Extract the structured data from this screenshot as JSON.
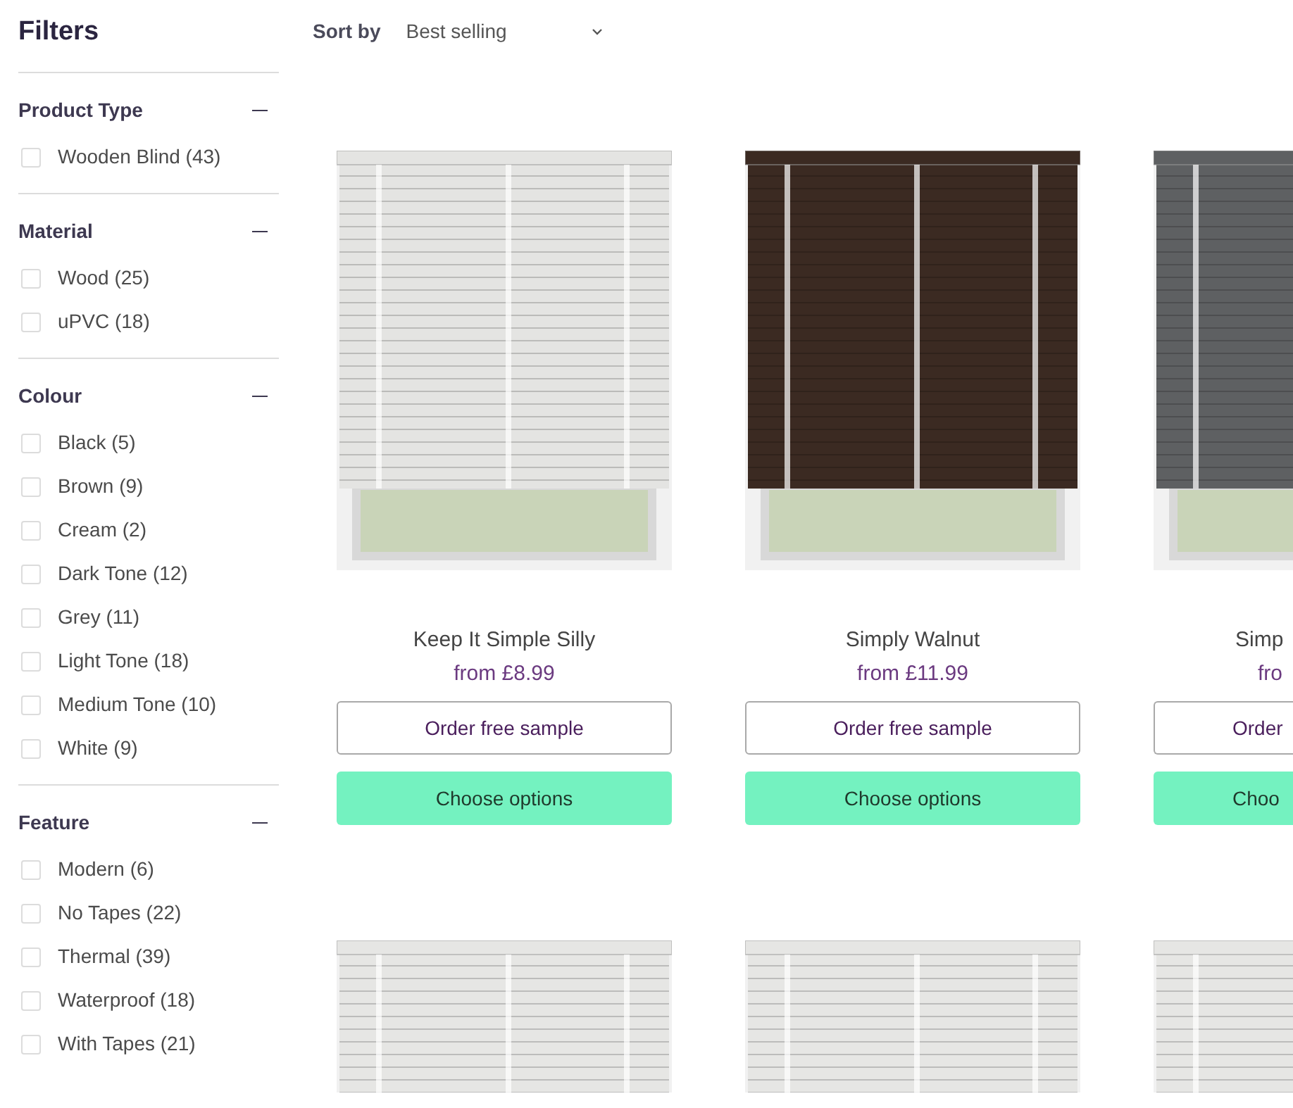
{
  "sidebar": {
    "title": "Filters",
    "sections": [
      {
        "title": "Product Type",
        "expanded": true,
        "options": [
          {
            "label": "Wooden Blind (43)",
            "checked": false
          }
        ]
      },
      {
        "title": "Material",
        "expanded": true,
        "options": [
          {
            "label": "Wood (25)",
            "checked": false
          },
          {
            "label": "uPVC (18)",
            "checked": false
          }
        ]
      },
      {
        "title": "Colour",
        "expanded": true,
        "options": [
          {
            "label": "Black (5)",
            "checked": false
          },
          {
            "label": "Brown (9)",
            "checked": false
          },
          {
            "label": "Cream (2)",
            "checked": false
          },
          {
            "label": "Dark Tone (12)",
            "checked": false
          },
          {
            "label": "Grey (11)",
            "checked": false
          },
          {
            "label": "Light Tone (18)",
            "checked": false
          },
          {
            "label": "Medium Tone (10)",
            "checked": false
          },
          {
            "label": "White (9)",
            "checked": false
          }
        ]
      },
      {
        "title": "Feature",
        "expanded": true,
        "options": [
          {
            "label": "Modern (6)",
            "checked": false
          },
          {
            "label": "No Tapes (22)",
            "checked": false
          },
          {
            "label": "Thermal (39)",
            "checked": false
          },
          {
            "label": "Waterproof (18)",
            "checked": false
          },
          {
            "label": "With Tapes (21)",
            "checked": false
          }
        ]
      }
    ]
  },
  "sort": {
    "label": "Sort by",
    "value": "Best selling"
  },
  "products": [
    {
      "name": "Keep It Simple Silly",
      "price": "from £8.99",
      "sample_button": "Order free sample",
      "options_button": "Choose options",
      "color": "#e4e4e2",
      "cut": false
    },
    {
      "name": "Simply Walnut",
      "price": "from £11.99",
      "sample_button": "Order free sample",
      "options_button": "Choose options",
      "color": "#3b2a22",
      "cut": false
    },
    {
      "name": "Simp",
      "price": "fro",
      "sample_button": "Order",
      "options_button": "Choo",
      "color": "#5e6062",
      "cut": true
    }
  ],
  "more_products": [
    {
      "color": "#e6e6e4",
      "cut": false
    },
    {
      "color": "#e6e6e4",
      "cut": false
    },
    {
      "color": "#e6e6e4",
      "cut": true
    }
  ]
}
